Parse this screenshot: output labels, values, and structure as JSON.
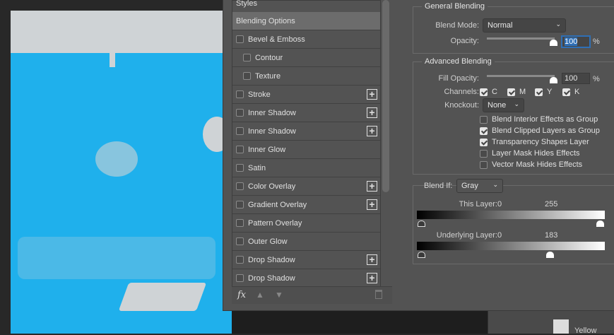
{
  "styles_panel": {
    "header": "Styles",
    "items": [
      {
        "label": "Blending Options",
        "selected": true
      },
      {
        "label": "Bevel & Emboss",
        "checked": false
      },
      {
        "label": "Contour",
        "checked": false,
        "indent": true
      },
      {
        "label": "Texture",
        "checked": false,
        "indent": true
      },
      {
        "label": "Stroke",
        "checked": false,
        "plus": true
      },
      {
        "label": "Inner Shadow",
        "checked": false,
        "plus": true
      },
      {
        "label": "Inner Shadow",
        "checked": false,
        "plus": true
      },
      {
        "label": "Inner Glow",
        "checked": false
      },
      {
        "label": "Satin",
        "checked": false
      },
      {
        "label": "Color Overlay",
        "checked": false,
        "plus": true
      },
      {
        "label": "Gradient Overlay",
        "checked": false,
        "plus": true
      },
      {
        "label": "Pattern Overlay",
        "checked": false
      },
      {
        "label": "Outer Glow",
        "checked": false
      },
      {
        "label": "Drop Shadow",
        "checked": false,
        "plus": true
      },
      {
        "label": "Drop Shadow",
        "checked": false,
        "plus": true
      }
    ],
    "footer": {
      "fx": "fx",
      "icons": [
        "move-up-icon",
        "move-down-icon",
        "trash-icon"
      ]
    }
  },
  "general": {
    "title": "General Blending",
    "blend_mode_label": "Blend Mode:",
    "blend_mode": "Normal",
    "opacity_label": "Opacity:",
    "opacity": "100",
    "opacity_percent": 100,
    "pct": "%"
  },
  "advanced": {
    "title": "Advanced Blending",
    "fill_label": "Fill Opacity:",
    "fill": "100",
    "fill_percent": 100,
    "pct": "%",
    "channels_label": "Channels:",
    "channels": [
      {
        "label": "C",
        "checked": true
      },
      {
        "label": "M",
        "checked": true
      },
      {
        "label": "Y",
        "checked": true
      },
      {
        "label": "K",
        "checked": true
      }
    ],
    "knockout_label": "Knockout:",
    "knockout": "None",
    "options": [
      {
        "label": "Blend Interior Effects as Group",
        "checked": false
      },
      {
        "label": "Blend Clipped Layers as Group",
        "checked": true
      },
      {
        "label": "Transparency Shapes Layer",
        "checked": true
      },
      {
        "label": "Layer Mask Hides Effects",
        "checked": false
      },
      {
        "label": "Vector Mask Hides Effects",
        "checked": false
      }
    ]
  },
  "blend_if": {
    "label": "Blend If:",
    "value": "Gray",
    "this_layer_label": "This Layer:",
    "this_low": "0",
    "this_high": "255",
    "under_label": "Underlying Layer:",
    "under_low": "0",
    "under_high": "183"
  },
  "layers": {
    "layer_name": "Yellow"
  },
  "colors": {
    "canvas": "#1fb0ec",
    "dialog": "#535353",
    "selected_row": "#6c6c6c"
  }
}
